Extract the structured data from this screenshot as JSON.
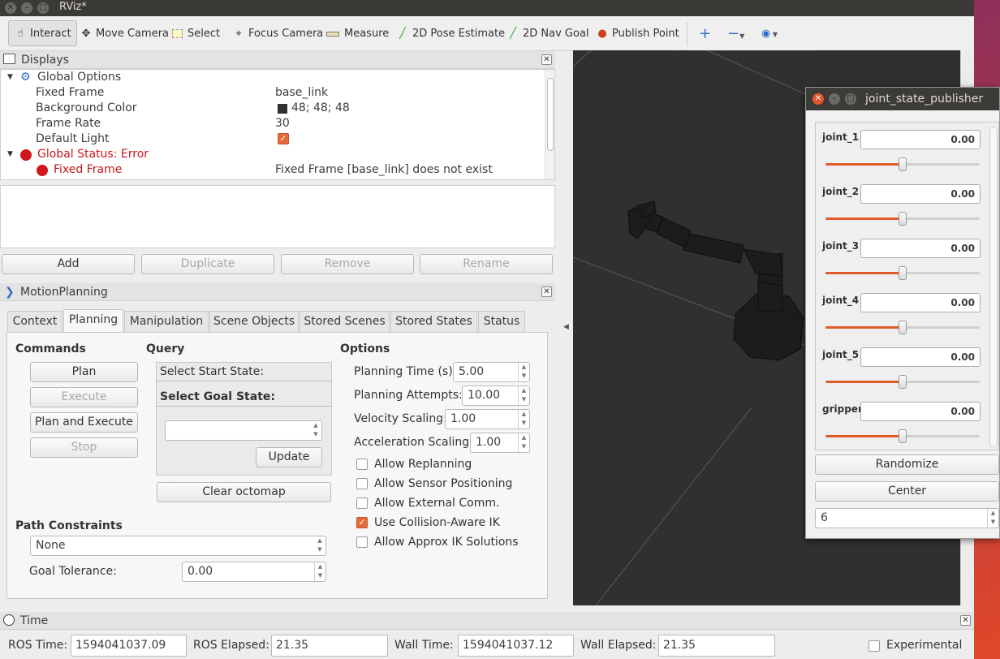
{
  "window": {
    "title": "RViz*"
  },
  "toolbar": {
    "tools": [
      "Interact",
      "Move Camera",
      "Select",
      "Focus Camera",
      "Measure",
      "2D Pose Estimate",
      "2D Nav Goal",
      "Publish Point"
    ]
  },
  "displays": {
    "title": "Displays",
    "rows": [
      {
        "label": "Global Options",
        "value": ""
      },
      {
        "label": "Fixed Frame",
        "value": "base_link"
      },
      {
        "label": "Background Color",
        "value": "48; 48; 48"
      },
      {
        "label": "Frame Rate",
        "value": "30"
      },
      {
        "label": "Default Light",
        "value": ""
      },
      {
        "label": "Global Status: Error",
        "value": ""
      },
      {
        "label": "Fixed Frame",
        "value": "Fixed Frame [base_link] does not exist"
      }
    ],
    "buttons": [
      "Add",
      "Duplicate",
      "Remove",
      "Rename"
    ]
  },
  "motion_planning": {
    "title": "MotionPlanning",
    "tabs": [
      "Context",
      "Planning",
      "Manipulation",
      "Scene Objects",
      "Stored Scenes",
      "Stored States",
      "Status"
    ],
    "commands": {
      "header": "Commands",
      "plan": "Plan",
      "execute": "Execute",
      "plan_execute": "Plan and Execute",
      "stop": "Stop"
    },
    "query": {
      "header": "Query",
      "start": "Select Start State:",
      "goal": "Select Goal State:",
      "update": "Update",
      "clear": "Clear octomap"
    },
    "options": {
      "header": "Options",
      "planning_time_label": "Planning Time (s):",
      "planning_time": "5.00",
      "planning_attempts_label": "Planning Attempts:",
      "planning_attempts": "10.00",
      "velocity_label": "Velocity Scaling:",
      "velocity": "1.00",
      "accel_label": "Acceleration Scaling:",
      "accel": "1.00",
      "checks": [
        {
          "label": "Allow Replanning",
          "checked": false
        },
        {
          "label": "Allow Sensor Positioning",
          "checked": false
        },
        {
          "label": "Allow External Comm.",
          "checked": false
        },
        {
          "label": "Use Collision-Aware IK",
          "checked": true
        },
        {
          "label": "Allow Approx IK Solutions",
          "checked": false
        }
      ]
    },
    "path": {
      "header": "Path Constraints",
      "value": "None",
      "tolerance_label": "Goal Tolerance:",
      "tolerance": "0.00"
    }
  },
  "joint_state_publisher": {
    "title": "joint_state_publisher",
    "joints": [
      {
        "name": "joint_1",
        "value": "0.00",
        "level": 0.5
      },
      {
        "name": "joint_2",
        "value": "0.00",
        "level": 0.5
      },
      {
        "name": "joint_3",
        "value": "0.00",
        "level": 0.5
      },
      {
        "name": "joint_4",
        "value": "0.00",
        "level": 0.5
      },
      {
        "name": "joint_5",
        "value": "0.00",
        "level": 0.5
      },
      {
        "name": "gripper_joint",
        "value": "0.00",
        "level": 0.5
      }
    ],
    "randomize": "Randomize",
    "center": "Center",
    "count": "6"
  },
  "time": {
    "title": "Time",
    "ros_time_label": "ROS Time:",
    "ros_time": "1594041037.09",
    "ros_elapsed_label": "ROS Elapsed:",
    "ros_elapsed": "21.35",
    "wall_time_label": "Wall Time:",
    "wall_time": "1594041037.12",
    "wall_elapsed_label": "Wall Elapsed:",
    "wall_elapsed": "21.35",
    "experimental": "Experimental"
  },
  "colors": {
    "accent": "#e05a2b",
    "error": "#c6171c",
    "viewport_bg": "#303030"
  }
}
